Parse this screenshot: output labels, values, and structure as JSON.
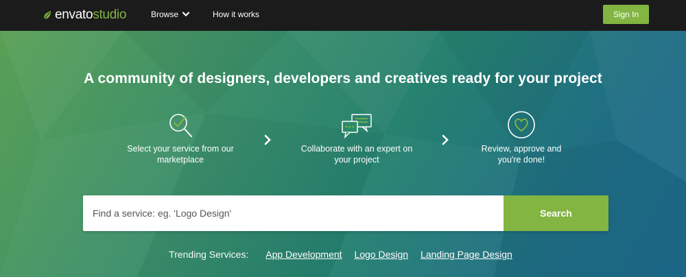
{
  "header": {
    "logo_bold": "envato",
    "logo_light": "studio",
    "nav": [
      {
        "label": "Browse"
      },
      {
        "label": "How it works"
      }
    ],
    "signin_label": "Sign In"
  },
  "hero": {
    "headline": "A community of designers, developers and creatives ready for your project",
    "steps": [
      {
        "line1": "Select your service from our",
        "line2": "marketplace",
        "icon": "search-check-icon"
      },
      {
        "line1": "Collaborate with an expert on",
        "line2": "your project",
        "icon": "chat-bubbles-icon"
      },
      {
        "line1": "Review, approve and",
        "line2": "you're done!",
        "icon": "heart-circle-icon"
      }
    ]
  },
  "search": {
    "placeholder": "Find a service: eg. 'Logo Design'",
    "button_label": "Search"
  },
  "trending": {
    "label": "Trending Services:",
    "links": [
      "App Development",
      "Logo Design",
      "Landing Page Design"
    ]
  },
  "colors": {
    "accent": "#82b541",
    "topbar": "#1b1b1b"
  }
}
